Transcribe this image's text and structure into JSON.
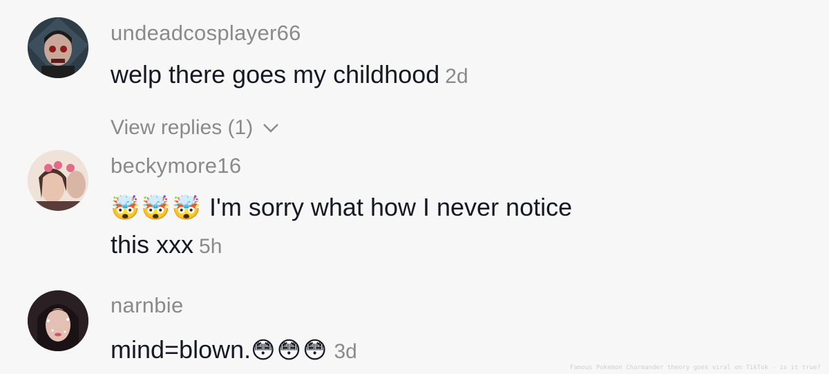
{
  "comments": [
    {
      "username": "undeadcosplayer66",
      "text": "welp there goes my childhood",
      "time": "2d",
      "view_replies": "View replies (1)"
    },
    {
      "username": "beckymore16",
      "emojis": [
        "🤯",
        "🤯",
        "🤯"
      ],
      "text_line1": "I'm sorry what how I never notice",
      "text_line2": "this xxx",
      "time": "5h"
    },
    {
      "username": "narnbie",
      "text": "mind=blown.",
      "emojis": [
        "😳",
        "😳",
        "😳"
      ],
      "time": "3d"
    }
  ],
  "watermark": "Famous Pokemon Charmander theory goes viral on TikTok - is it true?"
}
